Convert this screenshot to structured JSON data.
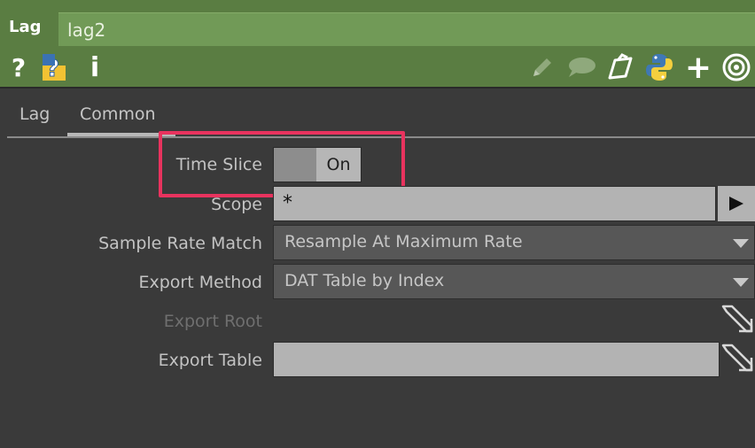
{
  "header": {
    "op_type": "Lag",
    "op_name": "lag2",
    "icons": [
      "help-icon",
      "python-help-icon",
      "info-icon",
      "pencil-icon",
      "comment-icon",
      "clone-icon",
      "python-icon",
      "plus-icon",
      "viewer-icon"
    ],
    "help_glyph": "?",
    "info_glyph": "i",
    "plus_glyph": "+"
  },
  "tabs": [
    {
      "label": "Lag",
      "active": false
    },
    {
      "label": "Common",
      "active": true
    }
  ],
  "params": {
    "time_slice": {
      "label": "Time Slice",
      "value": "On"
    },
    "scope": {
      "label": "Scope",
      "value": "*"
    },
    "sample_rate_match": {
      "label": "Sample Rate Match",
      "value": "Resample At Maximum Rate"
    },
    "export_method": {
      "label": "Export Method",
      "value": "DAT Table by Index"
    },
    "export_root": {
      "label": "Export Root",
      "value": "",
      "enabled": false
    },
    "export_table": {
      "label": "Export Table",
      "value": ""
    }
  },
  "colors": {
    "header_green": "#5a7d42",
    "name_field_green": "#719a57",
    "panel_bg": "#3a3a3a",
    "highlight": "#e8335e"
  }
}
